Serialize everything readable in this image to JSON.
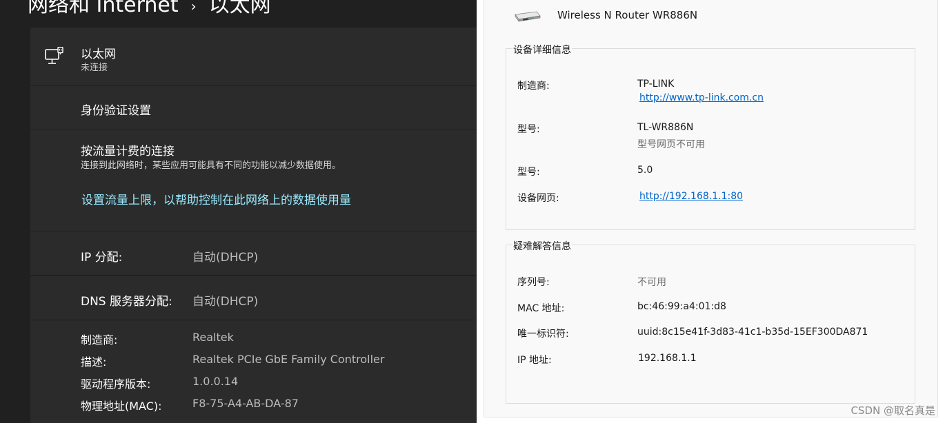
{
  "settings": {
    "breadcrumb": {
      "parent": "网络和 Internet",
      "separator": "›",
      "current": "以太网"
    },
    "ethernet": {
      "title": "以太网",
      "status": "未连接",
      "icon": "monitor-ethernet-icon"
    },
    "auth": {
      "label": "身份验证设置"
    },
    "metered": {
      "label": "按流量计费的连接",
      "description": "连接到此网络时，某些应用可能具有不同的功能以减少数据使用。",
      "link": "设置流量上限，以帮助控制在此网络上的数据使用量"
    },
    "ip": {
      "label": "IP 分配:",
      "value": "自动(DHCP)"
    },
    "dns": {
      "label": "DNS 服务器分配:",
      "value": "自动(DHCP)"
    },
    "properties": [
      {
        "label": "制造商:",
        "value": "Realtek"
      },
      {
        "label": "描述:",
        "value": "Realtek PCIe GbE Family Controller"
      },
      {
        "label": "驱动程序版本:",
        "value": "1.0.0.14"
      },
      {
        "label": "物理地址(MAC):",
        "value": "F8-75-A4-AB-DA-87"
      }
    ],
    "colors": {
      "background": "#202020",
      "card": "#2b2b2b",
      "link": "#99ebff"
    }
  },
  "dialog": {
    "device_name": "Wireless N Router WR886N",
    "device_icon": "router-icon",
    "details": {
      "legend": "设备详细信息",
      "manufacturer_label": "制造商:",
      "manufacturer_value": "TP-LINK",
      "manufacturer_url": "http://www.tp-link.com.cn",
      "model_label": "型号:",
      "model_value": "TL-WR886N",
      "model_note": "型号网页不可用",
      "model_number_label": "型号:",
      "model_number_value": "5.0",
      "webpage_label": "设备网页:",
      "webpage_value": "http://192.168.1.1:80"
    },
    "troubleshooting": {
      "legend": "疑难解答信息",
      "serial_label": "序列号:",
      "serial_value": "不可用",
      "mac_label": "MAC 地址:",
      "mac_value": "bc:46:99:a4:01:d8",
      "uid_label": "唯一标识符:",
      "uid_value": "uuid:8c15e41f-3d83-41c1-b35d-15EF300DA871",
      "ip_label": "IP 地址:",
      "ip_value": "192.168.1.1"
    },
    "colors": {
      "link": "#0066cc"
    }
  },
  "watermark": "CSDN @取名真是"
}
